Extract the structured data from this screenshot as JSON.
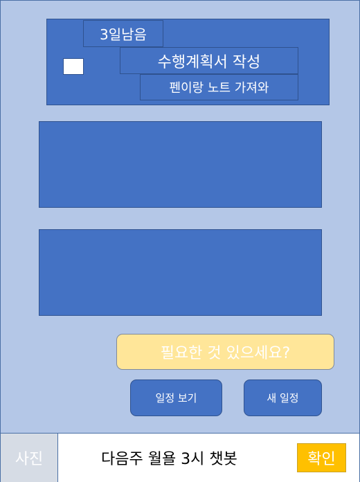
{
  "schedule_card": {
    "days_left": "3일남음",
    "task_title": "수행계획서 작성",
    "task_note": "펜이랑 노트 가져와"
  },
  "assistant": {
    "prompt": "필요한 것 있으세요?"
  },
  "actions": {
    "view_schedule": "일정 보기",
    "new_schedule": "새 일정"
  },
  "bottom_bar": {
    "photo_label": "사진",
    "message": "다음주 월욜 3시 챗봇",
    "confirm_label": "확인"
  },
  "colors": {
    "background": "#b4c7e7",
    "panel": "#4472c4",
    "prompt": "#ffe699",
    "confirm": "#ffc000"
  }
}
